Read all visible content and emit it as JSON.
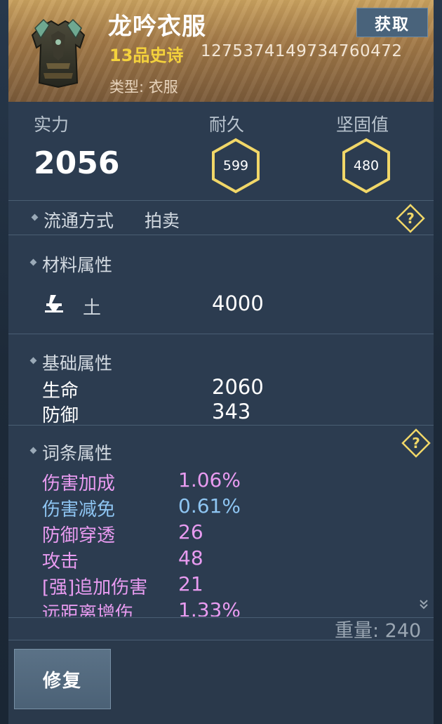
{
  "item": {
    "name": "龙吟衣服",
    "quality": "13品史诗",
    "id": "1275374149734760472",
    "type": "类型: 衣服",
    "obtain_label": "获取"
  },
  "stats": {
    "power_label": "实力",
    "power_value": "2056",
    "durability_label": "耐久",
    "durability_value": "599",
    "firmness_label": "坚固值",
    "firmness_value": "480"
  },
  "circulation": {
    "label": "流通方式",
    "value": "拍卖"
  },
  "material": {
    "title": "材料属性",
    "element_icon": "earth-element-icon",
    "element_name": "土",
    "element_value": "4000"
  },
  "base": {
    "title": "基础属性",
    "rows": [
      {
        "name": "生命",
        "value": "2060"
      },
      {
        "name": "防御",
        "value": "343"
      }
    ]
  },
  "affix": {
    "title": "词条属性",
    "rows": [
      {
        "name": "伤害加成",
        "value": "1.06%",
        "color": "#e89bf0"
      },
      {
        "name": "伤害减免",
        "value": "0.61%",
        "color": "#8ec5f2"
      },
      {
        "name": "防御穿透",
        "value": "26",
        "color": "#e89bf0"
      },
      {
        "name": "攻击",
        "value": "48",
        "color": "#e89bf0"
      },
      {
        "name": "[强]追加伤害",
        "value": "21",
        "color": "#e89bf0"
      },
      {
        "name": "远距离增伤",
        "value": "1.33%",
        "color": "#e89bf0"
      }
    ]
  },
  "footer": {
    "weight": "重量: 240",
    "repair_label": "修复"
  },
  "colors": {
    "accent_gold": "#f4d23c",
    "hex_border": "#f1d768",
    "affix_pink": "#e89bf0",
    "affix_blue": "#8ec5f2"
  }
}
